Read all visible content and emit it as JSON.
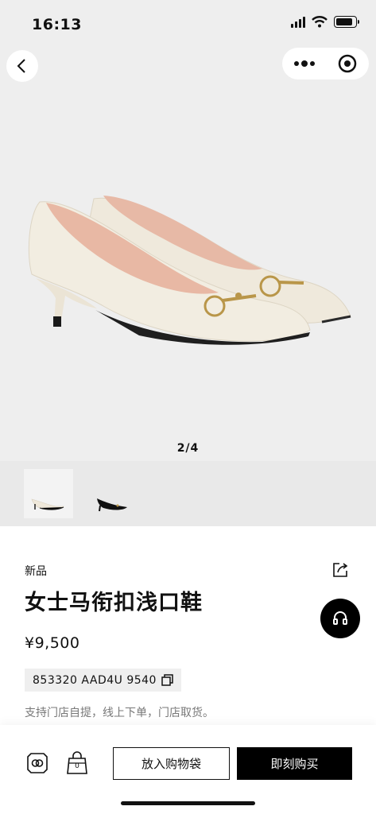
{
  "status": {
    "time": "16:13"
  },
  "gallery": {
    "indicator": "2/4"
  },
  "product": {
    "tag": "新品",
    "title": "女士马衔扣浅口鞋",
    "price": "¥9,500",
    "sku": "853320 AAD4U 9540",
    "pickup_note": "支持门店自提，线上下单，门店取货。"
  },
  "bottom": {
    "add_to_bag": "放入购物袋",
    "buy_now": "即刻购买",
    "bag_count": "0"
  },
  "colors": {
    "accent": "#000000",
    "hero_bg": "#eeeeee",
    "shoe": "#f1ece0"
  }
}
